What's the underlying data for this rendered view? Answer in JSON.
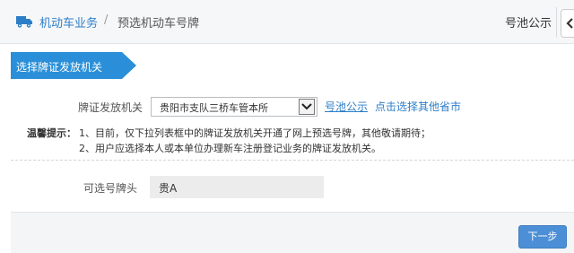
{
  "header": {
    "section_title": "机动车业务",
    "separator": "/",
    "page_title": "预选机动车号牌",
    "notice_link": "号池公示",
    "back_icon": "chevron-left-icon",
    "truck_icon": "truck-icon"
  },
  "step": {
    "label": "选择牌证发放机关",
    "color": "#2a8fd8"
  },
  "form": {
    "authority_label": "牌证发放机关",
    "authority_selected": "贵阳市支队三桥车管本所",
    "pool_notice_link": "号池公示",
    "other_province_link": "点击选择其他省市",
    "plate_label": "可选号牌头",
    "plate_value": "贵A"
  },
  "tips": {
    "title": "温馨提示：",
    "line1": "1、目前，仅下拉列表框中的牌证发放机关开通了网上预选号牌，其他敬请期待；",
    "line2": "2、用户应选择本人或本单位办理新车注册登记业务的牌证发放机关。"
  },
  "footer": {
    "next_button": "下一步"
  },
  "colors": {
    "accent": "#2d7ec8",
    "button": "#4d8fd6"
  }
}
